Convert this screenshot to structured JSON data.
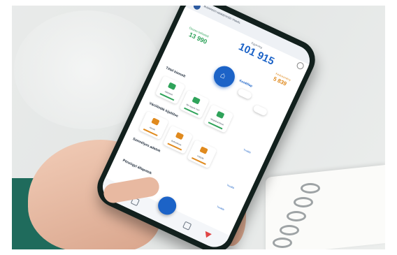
{
  "app": {
    "header_org": "BUDAPESTI NEMZETKÖZI TRAVEL",
    "total_label": "Egyenleg",
    "total_value": "101 915",
    "left_label": "Összes befizetett",
    "left_value": "13 990",
    "right_label": "Kedvezmény",
    "right_value": "5 839",
    "main_action_label": "Kezdőlap",
    "sections": [
      {
        "title": "Tétel kiemelt",
        "more": ""
      },
      {
        "title": "Várólisták kijelölve",
        "more": "Tovább"
      },
      {
        "title": "Személyes adatok",
        "more": "Tovább"
      },
      {
        "title": "Pénzügyi állapotok",
        "more": "Tovább"
      }
    ],
    "cards_row1": [
      {
        "label": "Ajánlatok",
        "icon": "document-icon",
        "color": "#2fa35a"
      },
      {
        "label": "Mit vegyek ma?",
        "icon": "cart-icon",
        "color": "#2fa35a"
      },
      {
        "label": "Megtakarítások",
        "icon": "chart-icon",
        "color": "#2fa35a"
      }
    ],
    "cards_row2": [
      {
        "label": "Akciók",
        "icon": "tag-icon",
        "color": "#e08a1e"
      },
      {
        "label": "Befizetések",
        "icon": "wallet-icon",
        "color": "#e08a1e"
      },
      {
        "label": "Kártyák",
        "icon": "card-icon",
        "color": "#e08a1e"
      }
    ],
    "accent": "#1c63c7",
    "green": "#2fa35a",
    "orange": "#e08a1e"
  }
}
